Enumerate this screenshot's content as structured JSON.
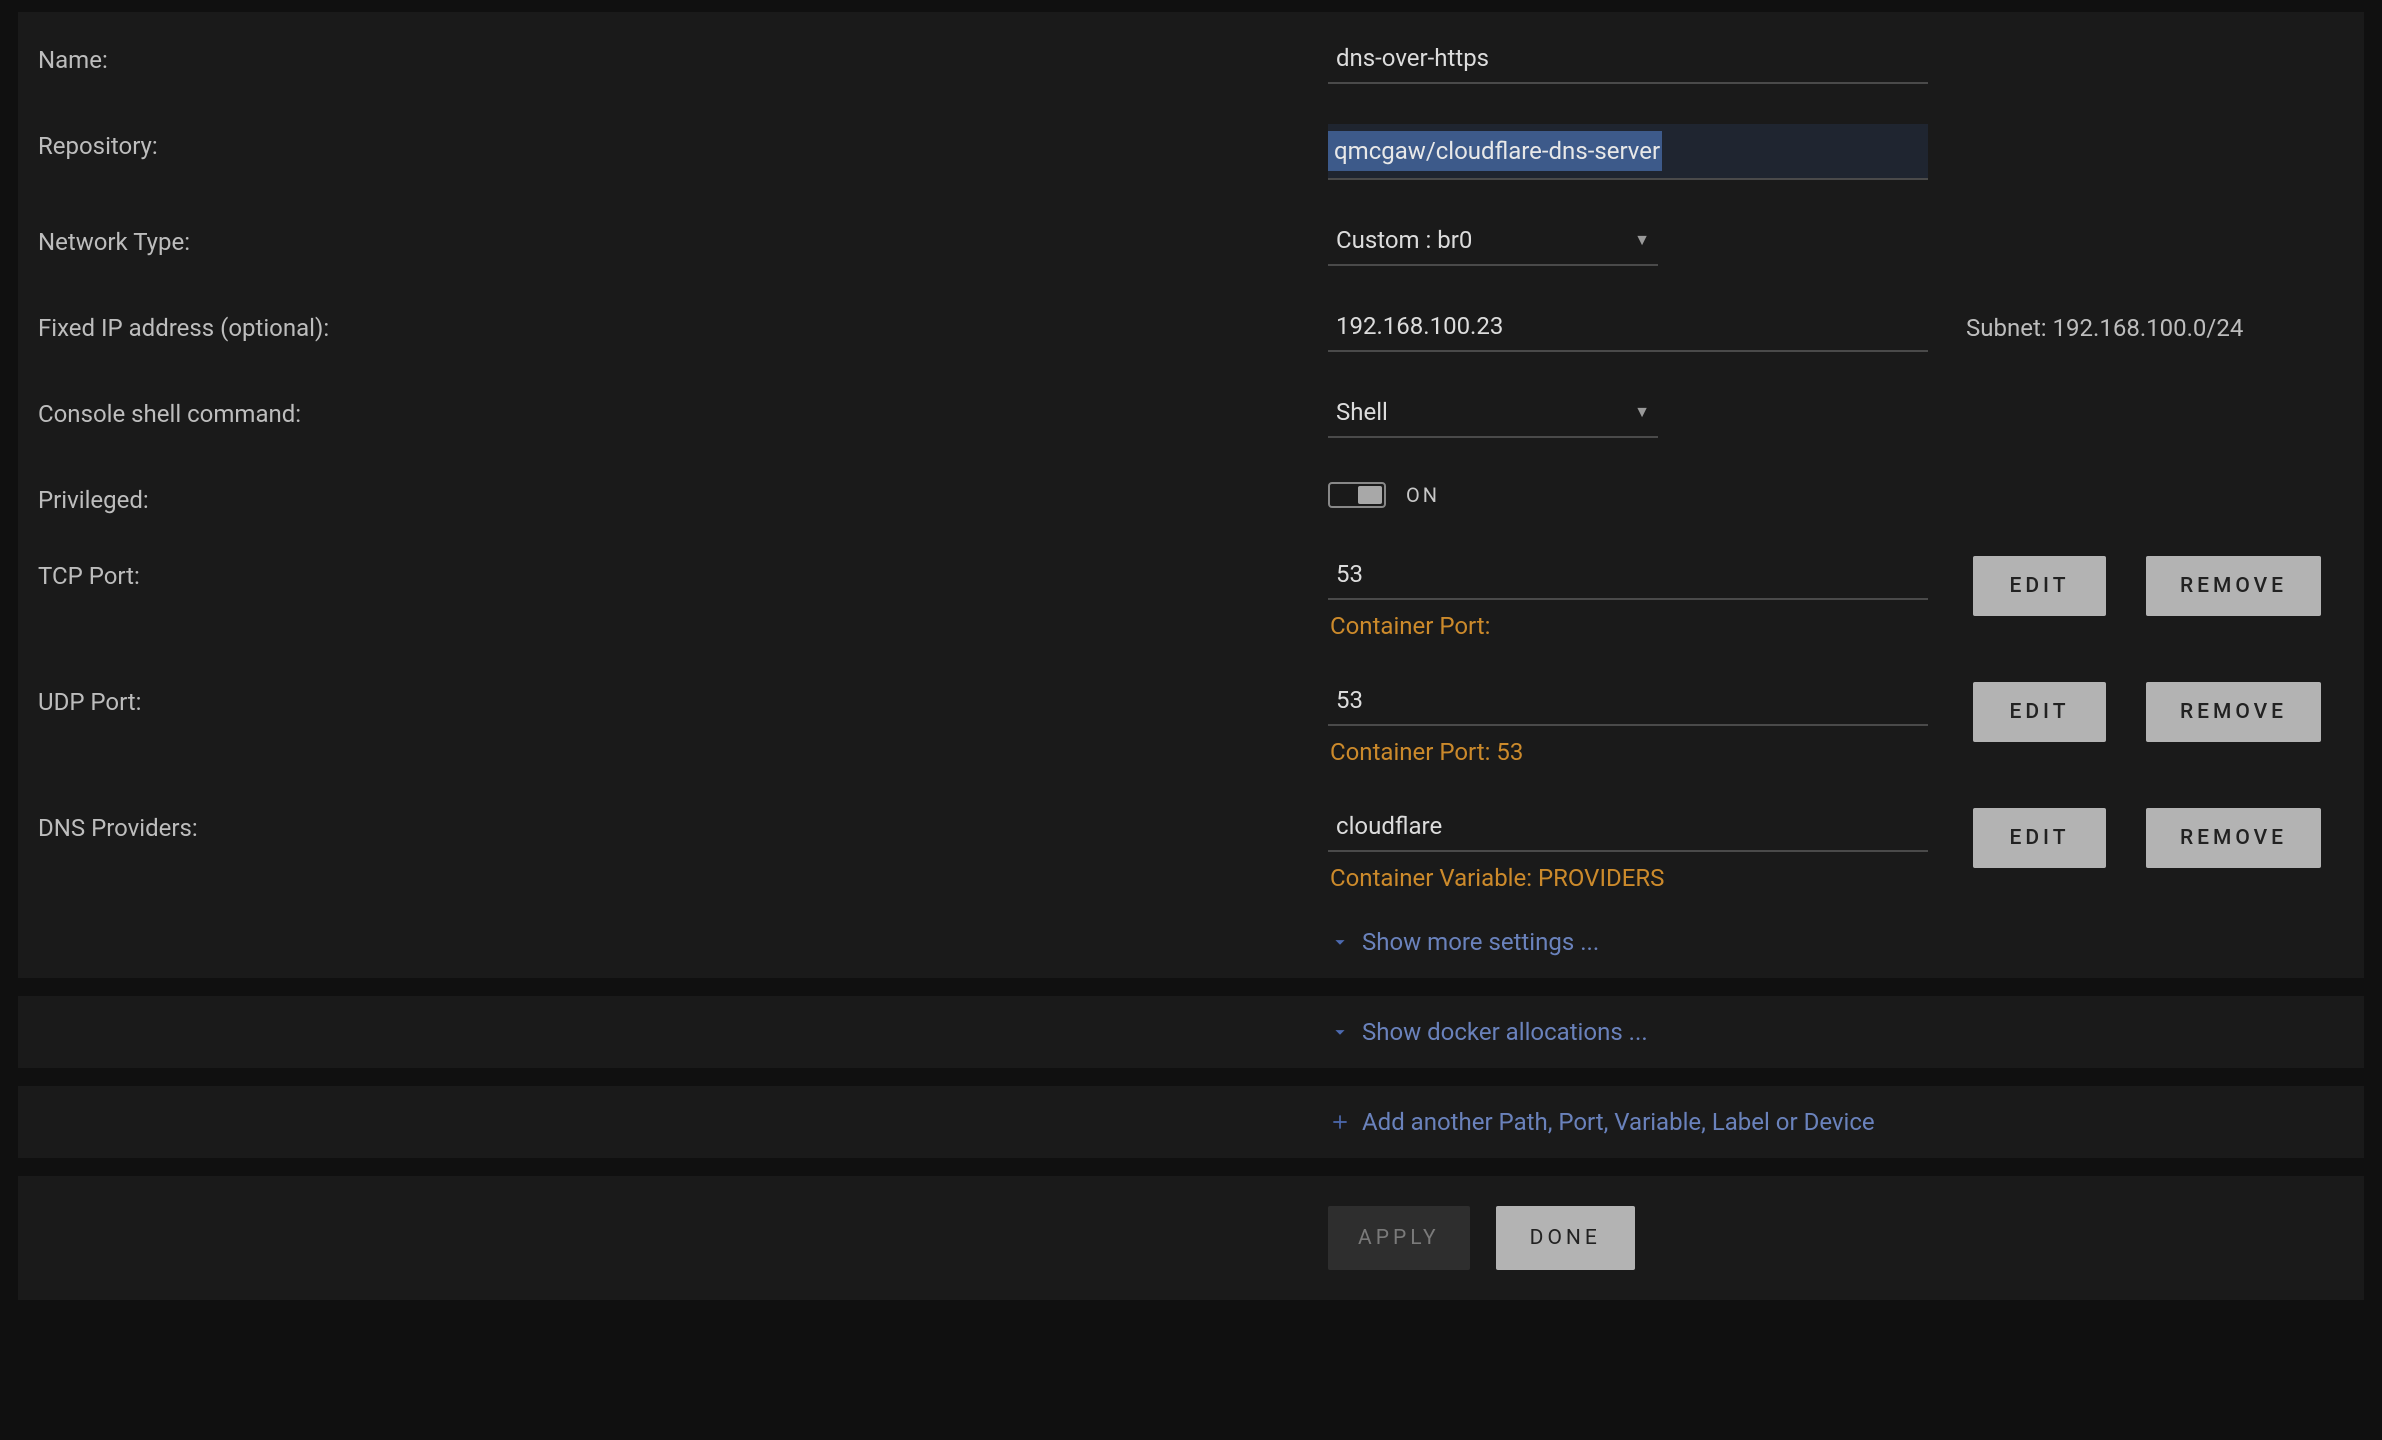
{
  "labels": {
    "name": "Name:",
    "repository": "Repository:",
    "network_type": "Network Type:",
    "fixed_ip": "Fixed IP address (optional):",
    "console_shell": "Console shell command:",
    "privileged": "Privileged:",
    "tcp_port": "TCP Port:",
    "udp_port": "UDP Port:",
    "dns_providers": "DNS Providers:"
  },
  "values": {
    "name": "dns-over-https",
    "repository": "qmcgaw/cloudflare-dns-server",
    "network_type": "Custom : br0",
    "fixed_ip": "192.168.100.23",
    "subnet": "Subnet: 192.168.100.0/24",
    "console_shell": "Shell",
    "privileged_state": "ON",
    "tcp_port": "53",
    "tcp_sub": "Container Port:",
    "udp_port": "53",
    "udp_sub": "Container Port: 53",
    "dns_providers": "cloudflare",
    "dns_sub": "Container Variable: PROVIDERS"
  },
  "buttons": {
    "edit": "EDIT",
    "remove": "REMOVE",
    "apply": "APPLY",
    "done": "DONE"
  },
  "links": {
    "show_more": "Show more settings ...",
    "show_docker": "Show docker allocations ...",
    "add_another": "Add another Path, Port, Variable, Label or Device"
  }
}
